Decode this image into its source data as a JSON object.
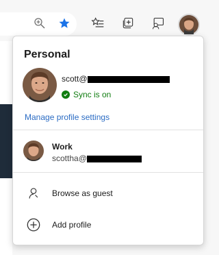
{
  "toolbar": {
    "icons": [
      "zoom-icon",
      "favorite-star-icon",
      "favorites-list-icon",
      "collections-icon",
      "feedback-icon",
      "profile-avatar"
    ],
    "accent": "#1a73e8"
  },
  "profile_flyout": {
    "section_title": "Personal",
    "primary_email_visible": "scott@",
    "sync_status": "Sync is on",
    "manage_link": "Manage profile settings",
    "other_profile": {
      "name": "Work",
      "email_visible": "scottha@"
    },
    "actions": [
      {
        "label": "Browse as guest",
        "icon": "guest-person-icon"
      },
      {
        "label": "Add profile",
        "icon": "add-circle-icon"
      }
    ]
  },
  "colors": {
    "sync_green": "#107c10",
    "link_blue": "#2b6cc4"
  }
}
